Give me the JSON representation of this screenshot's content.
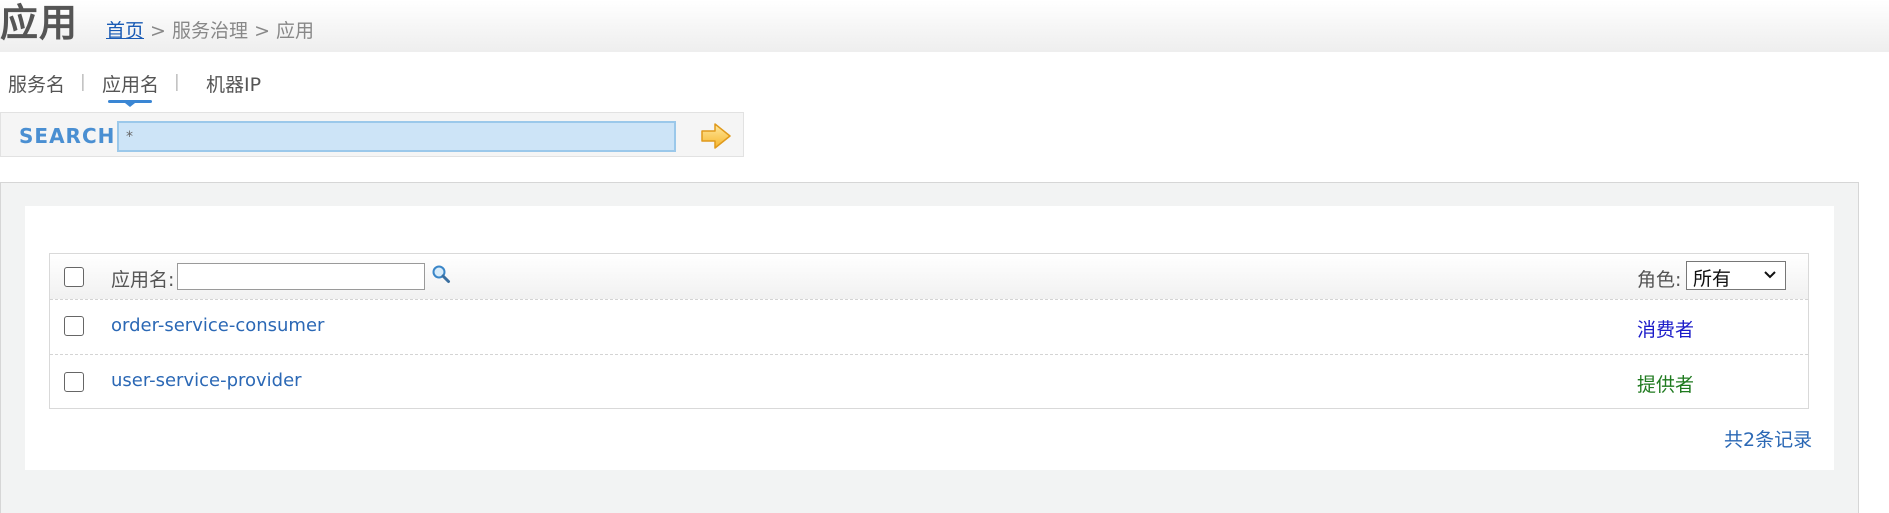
{
  "page": {
    "title": "应用"
  },
  "breadcrumb": {
    "home": "首页",
    "sep1": " > ",
    "section": "服务治理",
    "sep2": " > ",
    "current": "应用"
  },
  "tabs": {
    "items": [
      {
        "label": "服务名"
      },
      {
        "label": "应用名"
      },
      {
        "label": "机器IP"
      }
    ],
    "separator": "|",
    "active_index": 1
  },
  "search": {
    "label": "SEARCH",
    "value": "*",
    "go_icon": "arrow-right-icon"
  },
  "table": {
    "header": {
      "app_label": "应用名:",
      "app_filter_value": "",
      "filter_icon": "magnifier-icon",
      "role_label": "角色:",
      "role_selected": "所有"
    },
    "rows": [
      {
        "app": "order-service-consumer",
        "role": "消费者",
        "role_color": "#1c1cc9"
      },
      {
        "app": "user-service-provider",
        "role": "提供者",
        "role_color": "#1f7a1f"
      }
    ]
  },
  "footer": {
    "total": "共2条记录"
  }
}
